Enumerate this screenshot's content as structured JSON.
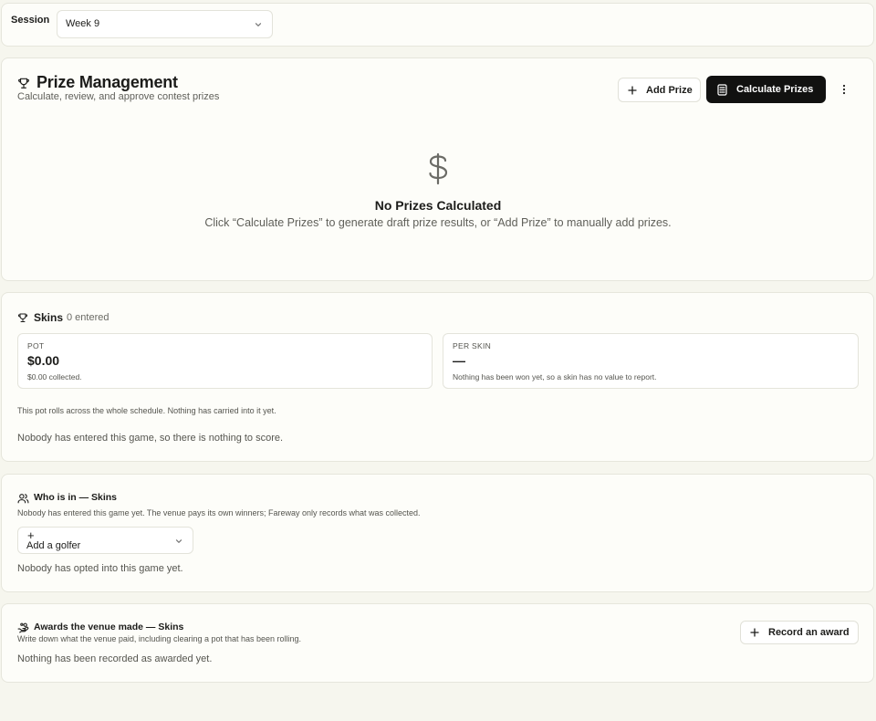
{
  "session": {
    "label": "Session",
    "selected": "Week 9"
  },
  "prize_management": {
    "title": "Prize Management",
    "subtitle": "Calculate, review, and approve contest prizes",
    "add_prize_label": "Add Prize",
    "calculate_prizes_label": "Calculate Prizes",
    "empty_title": "No Prizes Calculated",
    "empty_description": "Click “Calculate Prizes” to generate draft prize results, or “Add Prize” to manually add prizes."
  },
  "skins": {
    "title": "Skins",
    "entered": "0 entered",
    "pot": {
      "label": "POT",
      "value": "$0.00",
      "note": "$0.00 collected."
    },
    "per_skin": {
      "label": "PER SKIN",
      "value": "—",
      "note": "Nothing has been won yet, so a skin has no value to report."
    },
    "rolls_note": "This pot rolls across the whole schedule. Nothing has carried into it yet.",
    "empty": "Nobody has entered this game, so there is nothing to score."
  },
  "who_is_in": {
    "title": "Who is in — Skins",
    "description": "Nobody has entered this game yet. The venue pays its own winners; Fareway only records what was collected.",
    "add_golfer_plus": "+",
    "add_golfer_label": "Add a golfer",
    "empty": "Nobody has opted into this game yet."
  },
  "awards": {
    "title": "Awards the venue made — Skins",
    "description": "Write down what the venue paid, including clearing a pot that has been rolling.",
    "empty": "Nothing has been recorded as awarded yet.",
    "record_award_label": "Record an award"
  },
  "icons": {
    "trophy": "trophy-icon",
    "dollar": "dollar-icon",
    "users": "users-icon",
    "hand_coins": "hand-coins-icon",
    "calculator": "calculator-icon",
    "plus": "plus-icon",
    "chevron": "chevron-down-icon",
    "more": "more-vertical-icon"
  }
}
